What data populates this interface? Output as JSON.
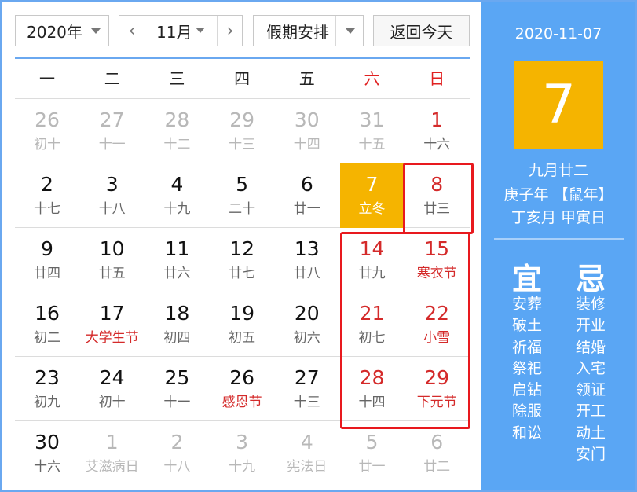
{
  "toolbar": {
    "year_value": "2020年",
    "month_value": "11月",
    "holiday_value": "假期安排",
    "today_label": "返回今天",
    "prev_glyph": "‹",
    "next_glyph": "›"
  },
  "weekdays": [
    "一",
    "二",
    "三",
    "四",
    "五",
    "六",
    "日"
  ],
  "weeks": [
    [
      {
        "num": "26",
        "lunar": "初十",
        "state": "muted"
      },
      {
        "num": "27",
        "lunar": "十一",
        "state": "muted"
      },
      {
        "num": "28",
        "lunar": "十二",
        "state": "muted"
      },
      {
        "num": "29",
        "lunar": "十三",
        "state": "muted"
      },
      {
        "num": "30",
        "lunar": "十四",
        "state": "muted"
      },
      {
        "num": "31",
        "lunar": "十五",
        "state": "muted"
      },
      {
        "num": "1",
        "lunar": "十六",
        "state": "weekend"
      }
    ],
    [
      {
        "num": "2",
        "lunar": "十七",
        "state": "normal"
      },
      {
        "num": "3",
        "lunar": "十八",
        "state": "normal"
      },
      {
        "num": "4",
        "lunar": "十九",
        "state": "normal"
      },
      {
        "num": "5",
        "lunar": "二十",
        "state": "normal"
      },
      {
        "num": "6",
        "lunar": "廿一",
        "state": "normal"
      },
      {
        "num": "7",
        "lunar": "立冬",
        "state": "selected"
      },
      {
        "num": "8",
        "lunar": "廿三",
        "state": "weekend"
      }
    ],
    [
      {
        "num": "9",
        "lunar": "廿四",
        "state": "normal"
      },
      {
        "num": "10",
        "lunar": "廿五",
        "state": "normal"
      },
      {
        "num": "11",
        "lunar": "廿六",
        "state": "normal"
      },
      {
        "num": "12",
        "lunar": "廿七",
        "state": "normal"
      },
      {
        "num": "13",
        "lunar": "廿八",
        "state": "normal"
      },
      {
        "num": "14",
        "lunar": "廿九",
        "state": "weekend"
      },
      {
        "num": "15",
        "lunar": "寒衣节",
        "state": "weekend-festival"
      }
    ],
    [
      {
        "num": "16",
        "lunar": "初二",
        "state": "normal"
      },
      {
        "num": "17",
        "lunar": "大学生节",
        "state": "festival"
      },
      {
        "num": "18",
        "lunar": "初四",
        "state": "normal"
      },
      {
        "num": "19",
        "lunar": "初五",
        "state": "normal"
      },
      {
        "num": "20",
        "lunar": "初六",
        "state": "normal"
      },
      {
        "num": "21",
        "lunar": "初七",
        "state": "weekend"
      },
      {
        "num": "22",
        "lunar": "小雪",
        "state": "weekend-festival"
      }
    ],
    [
      {
        "num": "23",
        "lunar": "初九",
        "state": "normal"
      },
      {
        "num": "24",
        "lunar": "初十",
        "state": "normal"
      },
      {
        "num": "25",
        "lunar": "十一",
        "state": "normal"
      },
      {
        "num": "26",
        "lunar": "感恩节",
        "state": "festival"
      },
      {
        "num": "27",
        "lunar": "十三",
        "state": "normal"
      },
      {
        "num": "28",
        "lunar": "十四",
        "state": "weekend"
      },
      {
        "num": "29",
        "lunar": "下元节",
        "state": "weekend-festival"
      }
    ],
    [
      {
        "num": "30",
        "lunar": "十六",
        "state": "normal"
      },
      {
        "num": "1",
        "lunar": "艾滋病日",
        "state": "muted"
      },
      {
        "num": "2",
        "lunar": "十八",
        "state": "muted"
      },
      {
        "num": "3",
        "lunar": "十九",
        "state": "muted"
      },
      {
        "num": "4",
        "lunar": "宪法日",
        "state": "muted"
      },
      {
        "num": "5",
        "lunar": "廿一",
        "state": "muted"
      },
      {
        "num": "6",
        "lunar": "廿二",
        "state": "muted"
      }
    ]
  ],
  "panel": {
    "date": "2020-11-07",
    "day": "7",
    "lunar_date": "九月廿二",
    "year_ganzhi": "庚子年 【鼠年】",
    "month_day_ganzhi": "丁亥月 甲寅日",
    "yi_label": "宜",
    "ji_label": "忌",
    "yi": [
      "安葬",
      "破土",
      "祈福",
      "祭祀",
      "启钻",
      "除服",
      "和讼"
    ],
    "ji": [
      "装修",
      "开业",
      "结婚",
      "入宅",
      "领证",
      "开工",
      "动土",
      "安门"
    ]
  },
  "colors": {
    "accent_blue": "#5aa6f4",
    "selected_gold": "#f5b400",
    "weekend_red": "#d42a2a",
    "highlight_box": "#e8191e"
  }
}
